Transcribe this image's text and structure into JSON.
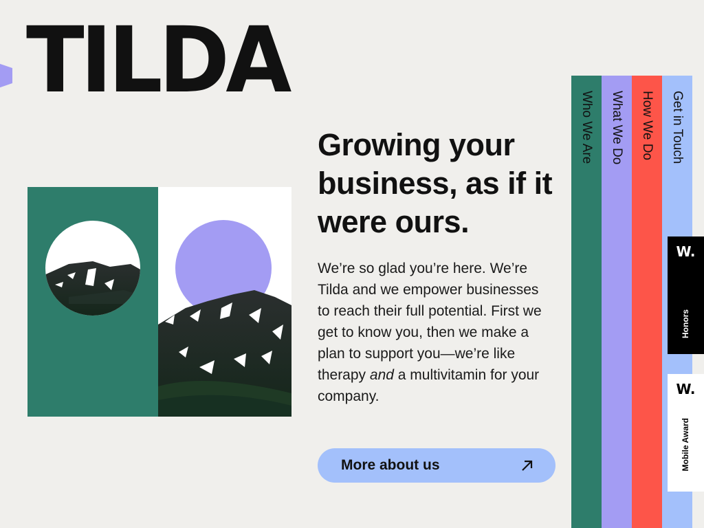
{
  "brand": {
    "logo_text": "TILDA"
  },
  "colors": {
    "background": "#f0efec",
    "green": "#2e7d6b",
    "lavender": "#a39cf3",
    "coral": "#fd5549",
    "sky": "#a3c0fb"
  },
  "hero": {
    "headline": "Growing your business, as if it were ours.",
    "intro_before": "We’re so glad you’re here. We’re Tilda and we empower businesses to reach their full potential. First we get to know you, then we make a plan to support you—we’re like therapy",
    "intro_emphasis": "and",
    "intro_after": "a multivitamin for your company.",
    "cta_label": "More about us",
    "cta_icon": "arrow-up-right-icon"
  },
  "nav": {
    "items": [
      {
        "label": "Who We Are",
        "color": "#2e7d6b"
      },
      {
        "label": "What We Do",
        "color": "#a39cf3"
      },
      {
        "label": "How We Do",
        "color": "#fd5549"
      },
      {
        "label": "Get in Touch",
        "color": "#a3c0fb"
      }
    ]
  },
  "awards": [
    {
      "mark": "W.",
      "label": "Honors",
      "theme": "dark"
    },
    {
      "mark": "W.",
      "label": "Mobile Award",
      "theme": "light"
    }
  ]
}
